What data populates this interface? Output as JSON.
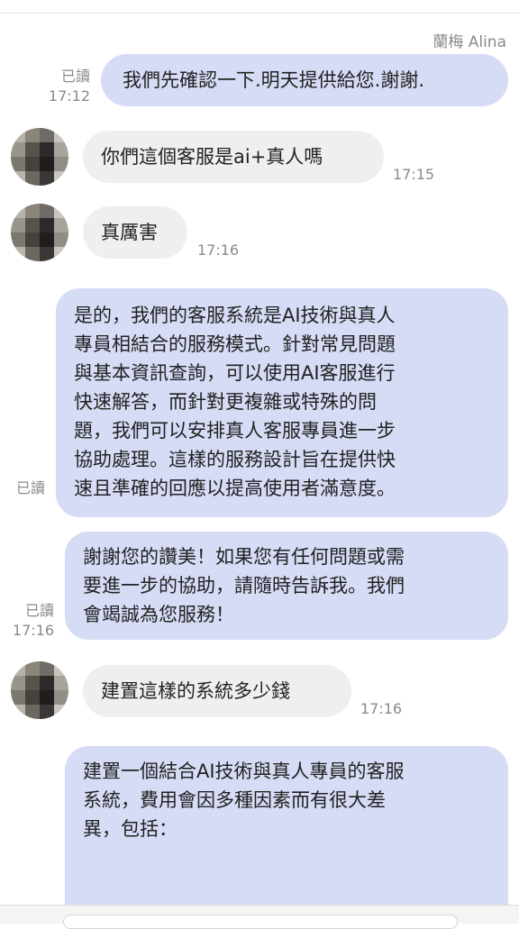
{
  "header": {
    "sender_name": "蘭梅 Alina"
  },
  "messages": [
    {
      "dir": "out",
      "text": "我們先確認一下.明天提供給您.謝謝.",
      "read": "已讀",
      "time": "17:12"
    },
    {
      "dir": "in",
      "text": "你們這個客服是ai+真人嗎",
      "time": "17:15"
    },
    {
      "dir": "in",
      "text": "真厲害",
      "time": "17:16"
    },
    {
      "dir": "out",
      "lines": [
        "是的，我們的客服系統是AI技術與真人",
        "專員相結合的服務模式。針對常見問題",
        "與基本資訊查詢，可以使用AI客服進行",
        "快速解答，而針對更複雜或特殊的問",
        "題，我們可以安排真人客服專員進一步",
        "協助處理。這樣的服務設計旨在提供快",
        "速且準確的回應以提高使用者滿意度。"
      ],
      "read": "已讀"
    },
    {
      "dir": "out",
      "lines": [
        "謝謝您的讚美！如果您有任何問題或需",
        "要進一步的協助，請隨時告訴我。我們",
        "會竭誠為您服務！"
      ],
      "read": "已讀",
      "time": "17:16"
    },
    {
      "dir": "in",
      "text": "建置這樣的系統多少錢",
      "time": "17:16"
    },
    {
      "dir": "out",
      "lines": [
        "建置一個結合AI技術與真人專員的客服",
        "系統，費用會因多種因素而有很大差",
        "異，包括："
      ]
    }
  ],
  "colors": {
    "outgoing_bubble": "#d6dcf5",
    "incoming_bubble": "#efeff1",
    "meta_text": "#8a8a8a"
  },
  "avatar": {
    "icon": "blurred-avatar-icon"
  }
}
